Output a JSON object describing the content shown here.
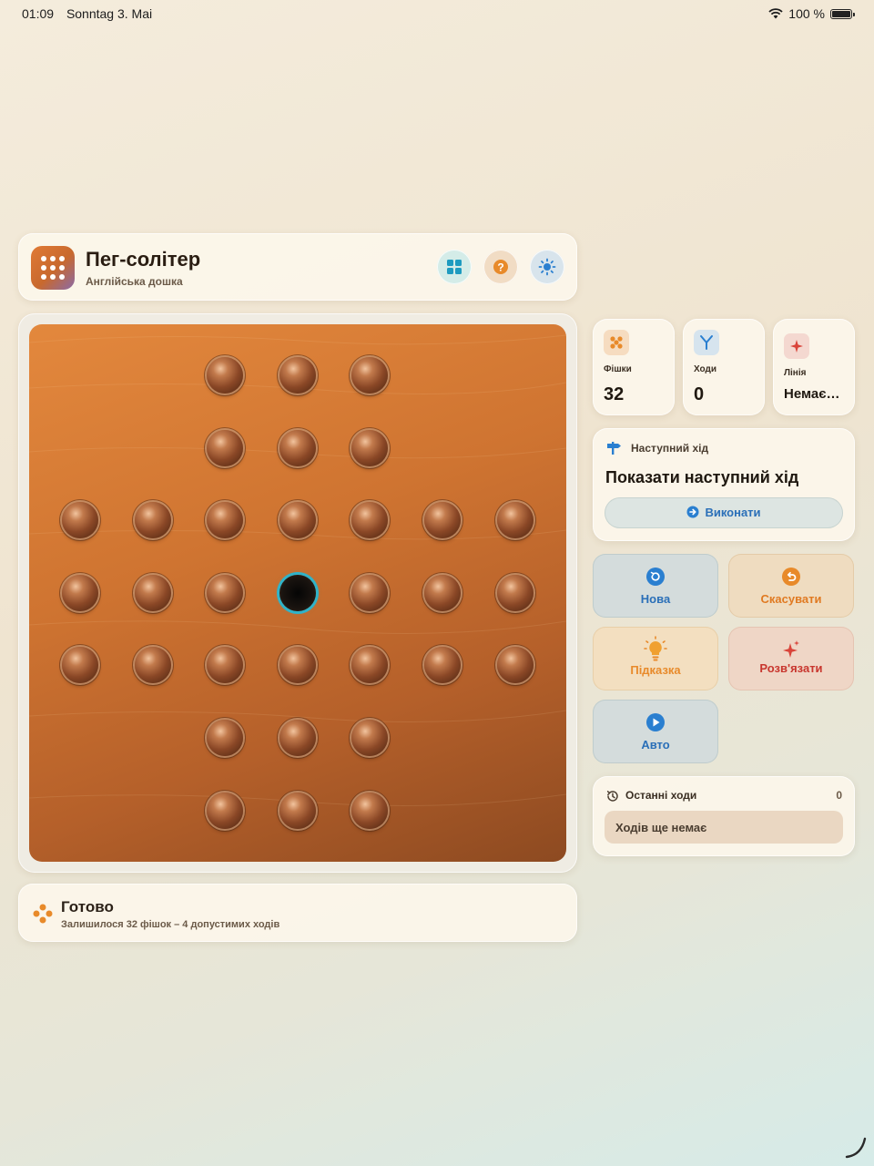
{
  "status": {
    "time": "01:09",
    "date": "Sonntag 3. Mai",
    "battery": "100 %",
    "battery_level": 1.0
  },
  "header": {
    "title": "Пег-солітер",
    "subtitle": "Англійська дошка",
    "icons": [
      "grid-icon",
      "help-icon",
      "theme-icon"
    ]
  },
  "board": {
    "layout": "english",
    "rows": [
      "..XXX..",
      "..XXX..",
      "XXXXXXX",
      "XXXOXXX",
      "XXXXXXX",
      "..XXX..",
      "..XXX.."
    ],
    "selected_hole": [
      3,
      3
    ],
    "colors": {
      "wood": "#cf7431",
      "peg": "#8a4726",
      "highlight": "#2fb3c9"
    }
  },
  "footer": {
    "title": "Готово",
    "subtitle": "Залишилося 32 фішок – 4 допустимих ходів"
  },
  "stats": [
    {
      "label": "Фішки",
      "value": "32",
      "icon": "pegs-icon"
    },
    {
      "label": "Ходи",
      "value": "0",
      "icon": "moves-icon"
    },
    {
      "label": "Лінія",
      "value": "Немає…",
      "icon": "sparkle-icon"
    }
  ],
  "next_move": {
    "label": "Наступний хід",
    "title": "Показати наступний хід",
    "button": "Виконати"
  },
  "actions": {
    "new": "Нова",
    "undo": "Скасувати",
    "hint": "Підказка",
    "solve": "Розв'язати",
    "auto": "Авто"
  },
  "recent": {
    "title": "Останні ходи",
    "count": "0",
    "empty": "Ходів ще немає"
  }
}
